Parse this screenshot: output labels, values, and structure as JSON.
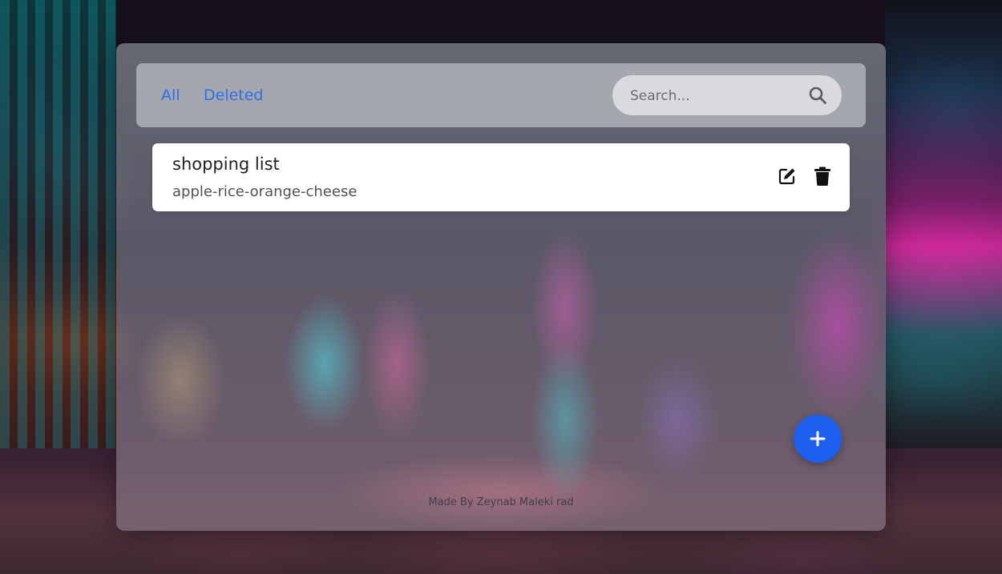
{
  "tabs": {
    "all": "All",
    "deleted": "Deleted"
  },
  "search": {
    "placeholder": "Search...",
    "value": "",
    "icon": "search-icon"
  },
  "notes": [
    {
      "title": "shopping list",
      "body": "apple-rice-orange-cheese",
      "actions": [
        "edit-icon",
        "trash-icon"
      ]
    }
  ],
  "fab": {
    "icon": "plus-icon"
  },
  "footer": {
    "credit": "Made By Zeynab Maleki rad"
  },
  "colors": {
    "accent": "#2e6fe8",
    "fab": "#1f5ff0",
    "card": "#ffffff"
  }
}
